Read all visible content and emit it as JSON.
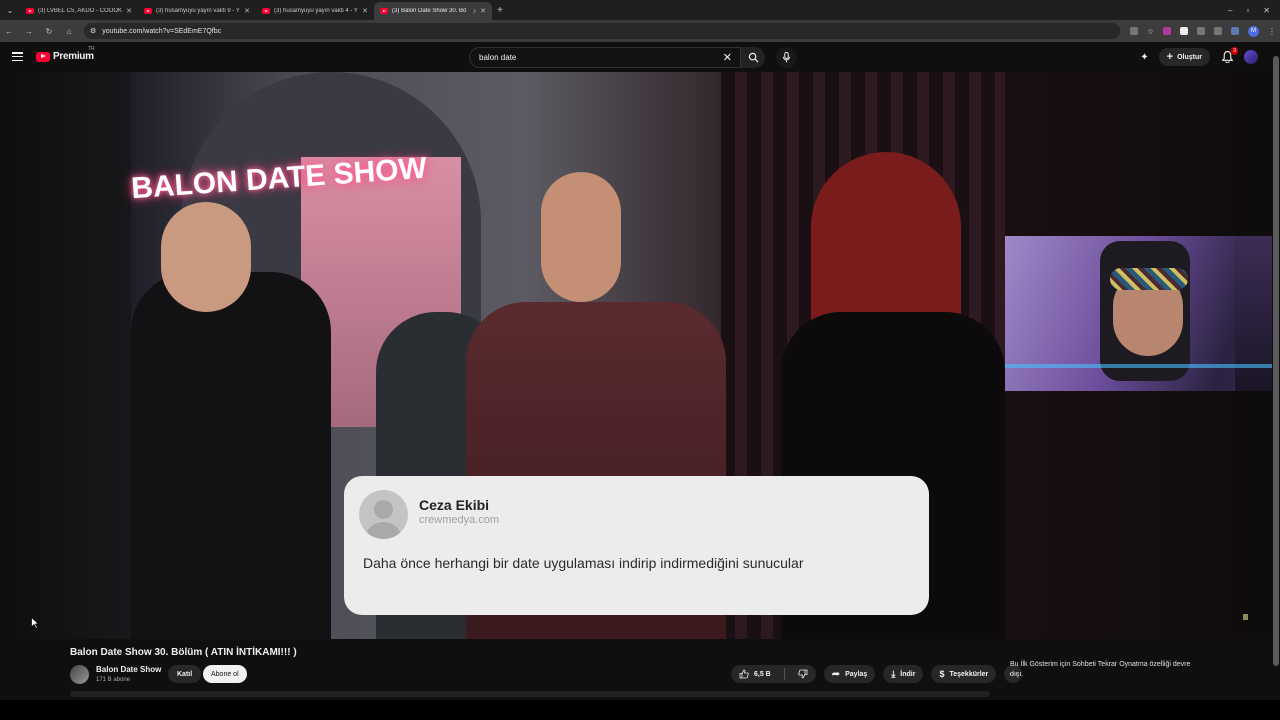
{
  "browser": {
    "tabs": [
      {
        "title": "(3) LVBEL C5, AKDO - COOOK I",
        "active": false
      },
      {
        "title": "(3) husamyuyu yayın vakti 9 - Y",
        "active": false
      },
      {
        "title": "(3) husamyuyu yayın vakti 4 - Y",
        "active": false
      },
      {
        "title": "(3) Balon Date Show 30. Bö",
        "active": true
      }
    ],
    "url": "youtube.com/watch?v=SEdEmE7Qfbc"
  },
  "youtube": {
    "logo_text": "Premium",
    "region": "TR",
    "search_value": "balon date",
    "create_label": "Oluştur",
    "notification_count": "3"
  },
  "overlay": {
    "name": "Ceza Ekibi",
    "domain": "crewmedya.com",
    "message": "Daha önce herhangi bir date uygulaması indirip indirmediğini sunucular"
  },
  "video_sign": "BALON DATE SHOW",
  "video": {
    "title": "Balon Date Show 30. Bölüm ( ATIN İNTİKAMI!!! )",
    "channel": "Balon Date Show",
    "subscribers": "171 B abone",
    "join_label": "Katıl",
    "subscribe_label": "Abone ol",
    "likes": "6,5 B",
    "share_label": "Paylaş",
    "download_label": "İndir",
    "thanks_label": "Teşekkürler",
    "side_note": "Bu İlk Gösterim için Sohbeti Tekrar Oynatma özelliği devre dışı."
  },
  "colors": {
    "brand_red": "#ff0033",
    "background": "#0f0f0f"
  }
}
